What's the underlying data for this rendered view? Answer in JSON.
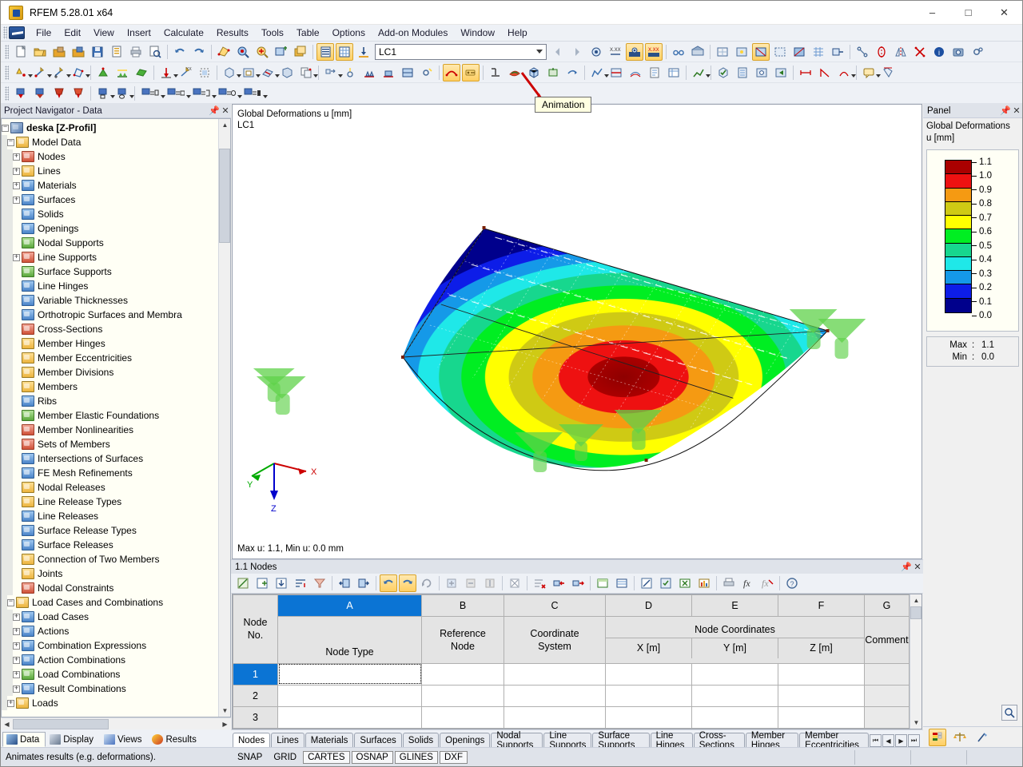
{
  "window": {
    "title": "RFEM 5.28.01 x64",
    "app_icon": "rfem-logo-icon",
    "minimize": "–",
    "maximize": "□",
    "close": "✕"
  },
  "menu": {
    "items": [
      {
        "label": "File"
      },
      {
        "label": "Edit"
      },
      {
        "label": "View"
      },
      {
        "label": "Insert"
      },
      {
        "label": "Calculate"
      },
      {
        "label": "Results"
      },
      {
        "label": "Tools"
      },
      {
        "label": "Table"
      },
      {
        "label": "Options"
      },
      {
        "label": "Add-on Modules"
      },
      {
        "label": "Window"
      },
      {
        "label": "Help"
      }
    ]
  },
  "toolbar_main": {
    "load_case_value": "LC1",
    "load_case_placeholder": "LC1"
  },
  "navigator": {
    "header": "Project Navigator - Data",
    "pin": "📌",
    "close": "✕",
    "tree": [
      {
        "label": "deska [Z-Profil]",
        "depth": 0,
        "toggle": "minus",
        "icon": "root",
        "bold": true
      },
      {
        "label": "Model Data",
        "depth": 1,
        "toggle": "minus",
        "icon": "folder",
        "bold": false
      },
      {
        "label": "Nodes",
        "depth": 2,
        "toggle": "plus",
        "icon": "red",
        "bold": false
      },
      {
        "label": "Lines",
        "depth": 2,
        "toggle": "plus",
        "icon": "folder",
        "bold": false
      },
      {
        "label": "Materials",
        "depth": 2,
        "toggle": "plus",
        "icon": "blue",
        "bold": false
      },
      {
        "label": "Surfaces",
        "depth": 2,
        "toggle": "plus",
        "icon": "blue",
        "bold": false
      },
      {
        "label": "Solids",
        "depth": 2,
        "toggle": "none",
        "icon": "blue",
        "bold": false
      },
      {
        "label": "Openings",
        "depth": 2,
        "toggle": "none",
        "icon": "blue",
        "bold": false
      },
      {
        "label": "Nodal Supports",
        "depth": 2,
        "toggle": "none",
        "icon": "grn",
        "bold": false
      },
      {
        "label": "Line Supports",
        "depth": 2,
        "toggle": "plus",
        "icon": "red",
        "bold": false
      },
      {
        "label": "Surface Supports",
        "depth": 2,
        "toggle": "none",
        "icon": "grn",
        "bold": false
      },
      {
        "label": "Line Hinges",
        "depth": 2,
        "toggle": "none",
        "icon": "blue",
        "bold": false
      },
      {
        "label": "Variable Thicknesses",
        "depth": 2,
        "toggle": "none",
        "icon": "blue",
        "bold": false
      },
      {
        "label": "Orthotropic Surfaces and Membra",
        "depth": 2,
        "toggle": "none",
        "icon": "blue",
        "bold": false
      },
      {
        "label": "Cross-Sections",
        "depth": 2,
        "toggle": "none",
        "icon": "red",
        "bold": false
      },
      {
        "label": "Member Hinges",
        "depth": 2,
        "toggle": "none",
        "icon": "folder",
        "bold": false
      },
      {
        "label": "Member Eccentricities",
        "depth": 2,
        "toggle": "none",
        "icon": "folder",
        "bold": false
      },
      {
        "label": "Member Divisions",
        "depth": 2,
        "toggle": "none",
        "icon": "folder",
        "bold": false
      },
      {
        "label": "Members",
        "depth": 2,
        "toggle": "none",
        "icon": "folder",
        "bold": false
      },
      {
        "label": "Ribs",
        "depth": 2,
        "toggle": "none",
        "icon": "blue",
        "bold": false
      },
      {
        "label": "Member Elastic Foundations",
        "depth": 2,
        "toggle": "none",
        "icon": "grn",
        "bold": false
      },
      {
        "label": "Member Nonlinearities",
        "depth": 2,
        "toggle": "none",
        "icon": "red",
        "bold": false
      },
      {
        "label": "Sets of Members",
        "depth": 2,
        "toggle": "none",
        "icon": "red",
        "bold": false
      },
      {
        "label": "Intersections of Surfaces",
        "depth": 2,
        "toggle": "none",
        "icon": "blue",
        "bold": false
      },
      {
        "label": "FE Mesh Refinements",
        "depth": 2,
        "toggle": "none",
        "icon": "blue",
        "bold": false
      },
      {
        "label": "Nodal Releases",
        "depth": 2,
        "toggle": "none",
        "icon": "folder",
        "bold": false
      },
      {
        "label": "Line Release Types",
        "depth": 2,
        "toggle": "none",
        "icon": "folder",
        "bold": false
      },
      {
        "label": "Line Releases",
        "depth": 2,
        "toggle": "none",
        "icon": "blue",
        "bold": false
      },
      {
        "label": "Surface Release Types",
        "depth": 2,
        "toggle": "none",
        "icon": "blue",
        "bold": false
      },
      {
        "label": "Surface Releases",
        "depth": 2,
        "toggle": "none",
        "icon": "blue",
        "bold": false
      },
      {
        "label": "Connection of Two Members",
        "depth": 2,
        "toggle": "none",
        "icon": "folder",
        "bold": false
      },
      {
        "label": "Joints",
        "depth": 2,
        "toggle": "none",
        "icon": "folder",
        "bold": false
      },
      {
        "label": "Nodal Constraints",
        "depth": 2,
        "toggle": "none",
        "icon": "red",
        "bold": false
      },
      {
        "label": "Load Cases and Combinations",
        "depth": 1,
        "toggle": "minus",
        "icon": "folder",
        "bold": false
      },
      {
        "label": "Load Cases",
        "depth": 2,
        "toggle": "plus",
        "icon": "blue",
        "bold": false
      },
      {
        "label": "Actions",
        "depth": 2,
        "toggle": "plus",
        "icon": "blue",
        "bold": false
      },
      {
        "label": "Combination Expressions",
        "depth": 2,
        "toggle": "plus",
        "icon": "blue",
        "bold": false
      },
      {
        "label": "Action Combinations",
        "depth": 2,
        "toggle": "plus",
        "icon": "blue",
        "bold": false
      },
      {
        "label": "Load Combinations",
        "depth": 2,
        "toggle": "plus",
        "icon": "grn",
        "bold": false
      },
      {
        "label": "Result Combinations",
        "depth": 2,
        "toggle": "plus",
        "icon": "blue",
        "bold": false
      },
      {
        "label": "Loads",
        "depth": 1,
        "toggle": "plus",
        "icon": "folder",
        "bold": false
      }
    ],
    "tabs": [
      {
        "label": "Data",
        "selected": true,
        "icon": "data-icon"
      },
      {
        "label": "Display",
        "selected": false,
        "icon": "display-icon"
      },
      {
        "label": "Views",
        "selected": false,
        "icon": "views-icon"
      },
      {
        "label": "Results",
        "selected": false,
        "icon": "results-icon"
      }
    ]
  },
  "viewport": {
    "label_line1": "Global Deformations u [mm]",
    "label_line2": "LC1",
    "status": "Max u: 1.1, Min u: 0.0 mm",
    "axes": [
      {
        "name": "X",
        "color": "#cc0000"
      },
      {
        "name": "Y",
        "color": "#00aa00"
      },
      {
        "name": "Z",
        "color": "#0000cc"
      }
    ]
  },
  "tooltip": {
    "text": "Animation"
  },
  "panel": {
    "header": "Panel",
    "pin": "📌",
    "close": "✕",
    "title_line1": "Global Deformations",
    "title_line2": "u [mm]",
    "max_label": "Max",
    "min_label": "Min",
    "max_value": "1.1",
    "min_value": "0.0",
    "colon": ":"
  },
  "chart_data": {
    "type": "heatmap",
    "title": "Global Deformations u [mm]",
    "subtitle": "LC1",
    "unit": "mm",
    "quantity": "u",
    "load_case": "LC1",
    "legend_position": "right",
    "max": 1.1,
    "min": 0.0,
    "tick_labels": [
      "1.1",
      "1.0",
      "0.9",
      "0.8",
      "0.7",
      "0.6",
      "0.5",
      "0.4",
      "0.3",
      "0.2",
      "0.1",
      "0.0"
    ],
    "band_colors": [
      "#aa0000",
      "#ee1111",
      "#f59a12",
      "#cfca14",
      "#ffff00",
      "#00ee22",
      "#17d78e",
      "#1fe8e8",
      "#1599e8",
      "#0d1de8",
      "#00008c"
    ],
    "bands": [
      {
        "from": 1.0,
        "to": 1.1,
        "color": "#aa0000"
      },
      {
        "from": 0.9,
        "to": 1.0,
        "color": "#ee1111"
      },
      {
        "from": 0.8,
        "to": 0.9,
        "color": "#f59a12"
      },
      {
        "from": 0.7,
        "to": 0.8,
        "color": "#cfca14"
      },
      {
        "from": 0.6,
        "to": 0.7,
        "color": "#ffff00"
      },
      {
        "from": 0.5,
        "to": 0.6,
        "color": "#00ee22"
      },
      {
        "from": 0.4,
        "to": 0.5,
        "color": "#17d78e"
      },
      {
        "from": 0.3,
        "to": 0.4,
        "color": "#1fe8e8"
      },
      {
        "from": 0.2,
        "to": 0.3,
        "color": "#1599e8"
      },
      {
        "from": 0.1,
        "to": 0.2,
        "color": "#0d1de8"
      },
      {
        "from": 0.0,
        "to": 0.1,
        "color": "#00008c"
      }
    ]
  },
  "table": {
    "header": "1.1 Nodes",
    "pin": "📌",
    "close": "✕",
    "column_letters": [
      "A",
      "B",
      "C",
      "D",
      "E",
      "F",
      "G"
    ],
    "selected_column": "A",
    "row_corner": "Node\nNo.",
    "group_header": "Node Coordinates",
    "headers": [
      "Node Type",
      "Reference\nNode",
      "Coordinate\nSystem",
      "X [m]",
      "Y [m]",
      "Z [m]",
      "Comment"
    ],
    "rows": [
      {
        "no": "1",
        "selected": true,
        "cells": [
          "",
          "",
          "",
          "",
          "",
          "",
          ""
        ]
      },
      {
        "no": "2",
        "selected": false,
        "cells": [
          "",
          "",
          "",
          "",
          "",
          "",
          ""
        ]
      },
      {
        "no": "3",
        "selected": false,
        "cells": [
          "",
          "",
          "",
          "",
          "",
          "",
          ""
        ]
      }
    ],
    "tabs": [
      {
        "label": "Nodes",
        "selected": true
      },
      {
        "label": "Lines",
        "selected": false
      },
      {
        "label": "Materials",
        "selected": false
      },
      {
        "label": "Surfaces",
        "selected": false
      },
      {
        "label": "Solids",
        "selected": false
      },
      {
        "label": "Openings",
        "selected": false
      },
      {
        "label": "Nodal Supports",
        "selected": false
      },
      {
        "label": "Line Supports",
        "selected": false
      },
      {
        "label": "Surface Supports",
        "selected": false
      },
      {
        "label": "Line Hinges",
        "selected": false
      },
      {
        "label": "Cross-Sections",
        "selected": false
      },
      {
        "label": "Member Hinges",
        "selected": false
      },
      {
        "label": "Member Eccentricities",
        "selected": false
      }
    ],
    "nav_buttons": [
      "⏮",
      "◀",
      "▶",
      "⏭"
    ]
  },
  "statusbar": {
    "message": "Animates results (e.g. deformations).",
    "toggles": [
      {
        "label": "SNAP",
        "on": false
      },
      {
        "label": "GRID",
        "on": false
      },
      {
        "label": "CARTES",
        "on": true
      },
      {
        "label": "OSNAP",
        "on": true
      },
      {
        "label": "GLINES",
        "on": true
      },
      {
        "label": "DXF",
        "on": true
      }
    ]
  }
}
